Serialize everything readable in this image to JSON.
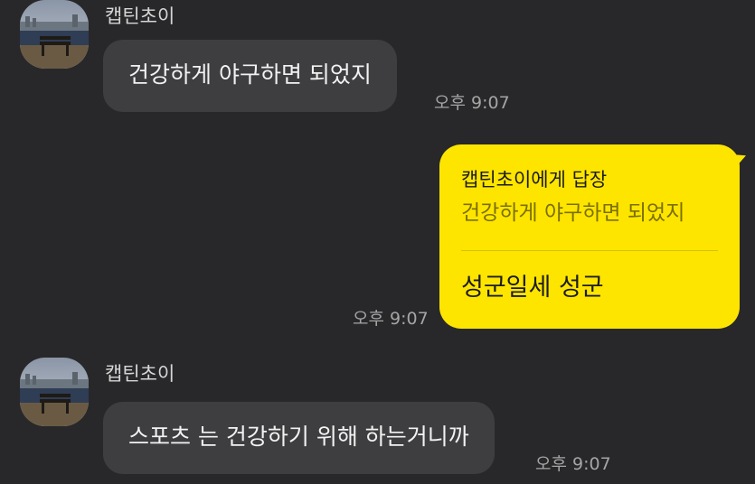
{
  "messages": [
    {
      "sender": "캡틴초이",
      "text": "건강하게 야구하면  되었지",
      "time": "오후 9:07"
    },
    {
      "reply_to": "캡틴초이에게 답장",
      "quote": "건강하게 야구하면  되었지",
      "text": "성군일세 성군",
      "time": "오후 9:07"
    },
    {
      "sender": "캡틴초이",
      "text": "스포츠 는 건강하기 위해 하는거니까",
      "time": "오후 9:07"
    }
  ],
  "colors": {
    "background": "#28282a",
    "incoming_bubble": "#3e3e40",
    "outgoing_bubble": "#fee500"
  },
  "icons": {
    "avatar": "profile-photo-bench-by-river"
  }
}
